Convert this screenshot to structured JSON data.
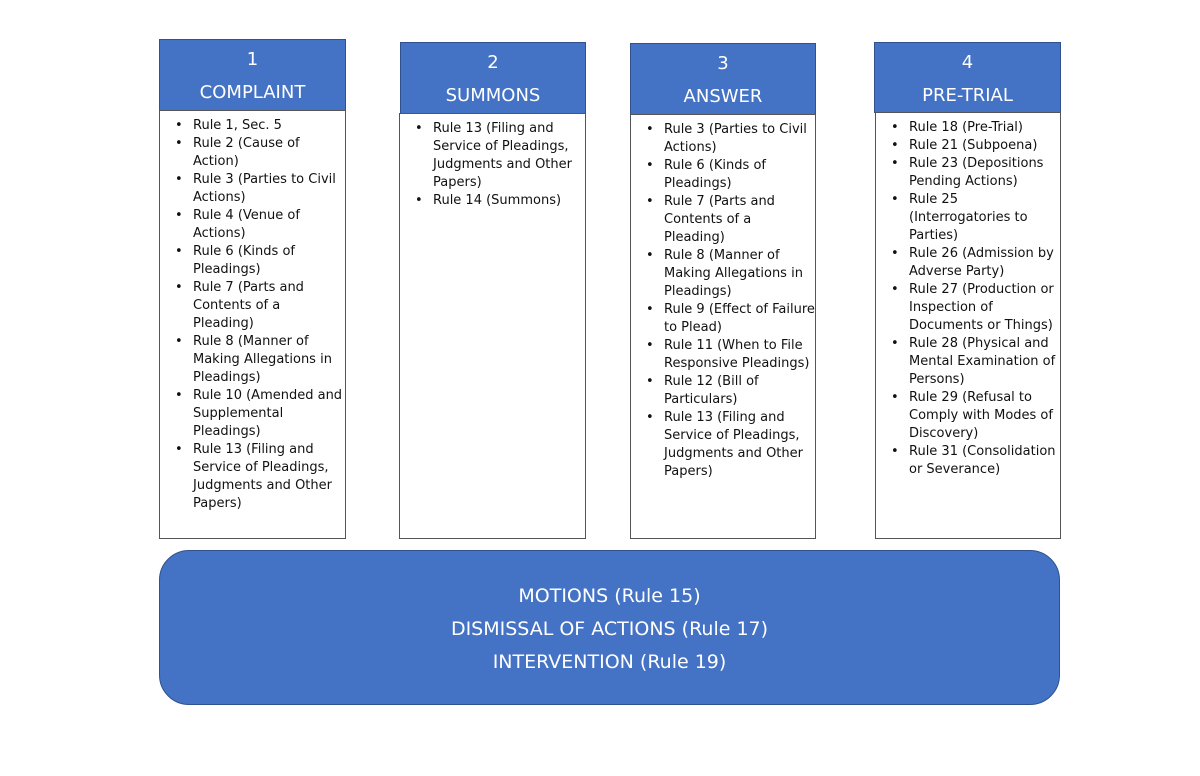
{
  "columns": [
    {
      "number": "1",
      "title": "COMPLAINT",
      "items": [
        "Rule 1, Sec. 5",
        "Rule 2 (Cause of Action)",
        "Rule 3 (Parties to Civil Actions)",
        "Rule 4 (Venue of Actions)",
        "Rule 6 (Kinds of Pleadings)",
        "Rule 7 (Parts and Contents of a Pleading)",
        "Rule 8 (Manner of Making Allegations in Pleadings)",
        "Rule 10 (Amended and Supplemental Pleadings)",
        "Rule 13 (Filing and Service of Pleadings, Judgments and Other Papers)"
      ]
    },
    {
      "number": "2",
      "title": "SUMMONS",
      "items": [
        "Rule 13 (Filing and Service of Pleadings, Judgments and Other Papers)",
        "Rule 14 (Summons)"
      ]
    },
    {
      "number": "3",
      "title": "ANSWER",
      "items": [
        "Rule 3 (Parties to Civil Actions)",
        "Rule 6 (Kinds of Pleadings)",
        "Rule 7 (Parts and Contents of a Pleading)",
        "Rule 8 (Manner of Making Allegations in Pleadings)",
        "Rule 9 (Effect of Failure to Plead)",
        "Rule 11 (When to File Responsive Pleadings)",
        "Rule 12 (Bill of Particulars)",
        "Rule 13 (Filing and Service of Pleadings, Judgments and Other Papers)"
      ]
    },
    {
      "number": "4",
      "title": "PRE-TRIAL",
      "items": [
        "Rule 18 (Pre-Trial)",
        "Rule 21 (Subpoena)",
        "Rule 23 (Depositions Pending Actions)",
        "Rule 25 (Interrogatories to Parties)",
        "Rule 26 (Admission by Adverse Party)",
        "Rule 27 (Production or Inspection of Documents or Things)",
        "Rule 28 (Physical and Mental Examination of Persons)",
        "Rule 29 (Refusal to Comply with Modes of Discovery)",
        "Rule 31 (Consolidation or Severance)"
      ]
    }
  ],
  "bottom": [
    "MOTIONS (Rule 15)",
    "DISMISSAL OF ACTIONS (Rule 17)",
    "INTERVENTION (Rule 19)"
  ],
  "colors": {
    "header_fill": "#4472c4",
    "header_border": "#2f528f"
  }
}
